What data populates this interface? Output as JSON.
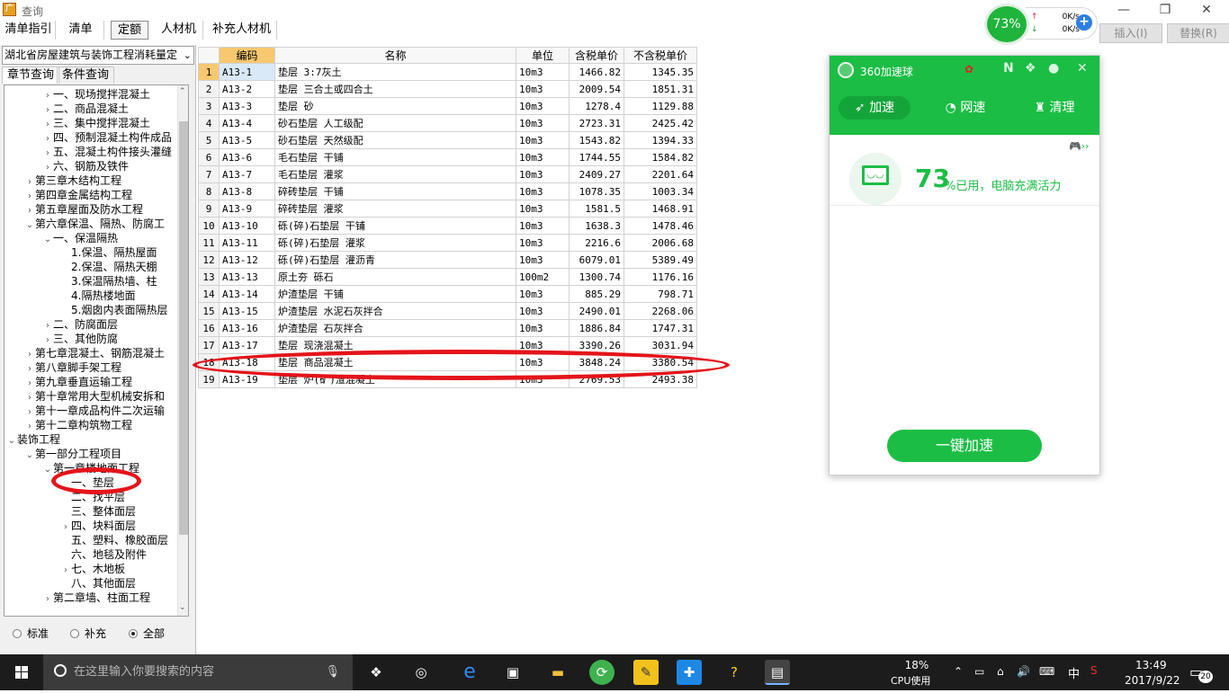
{
  "window": {
    "title": "查询",
    "minimize": "—",
    "maximize": "❐",
    "close": "✕"
  },
  "toolbar": {
    "tabs": [
      "清单指引",
      "清单",
      "定额",
      "人材机",
      "补充人材机"
    ],
    "active_tab": "定额",
    "insert_button": "插入(I)",
    "replace_button": "替换(R)"
  },
  "left_panel": {
    "standard_select": "湖北省房屋建筑与装饰工程消耗量定",
    "tabs": [
      "章节查询",
      "条件查询"
    ],
    "active_tab": "章节查询",
    "tree": [
      {
        "label": "一、现场搅拌混凝土",
        "level": 3,
        "expand": "›"
      },
      {
        "label": "二、商品混凝土",
        "level": 3,
        "expand": "›"
      },
      {
        "label": "三、集中搅拌混凝土",
        "level": 3,
        "expand": "›"
      },
      {
        "label": "四、预制混凝土构件成品",
        "level": 3,
        "expand": "›"
      },
      {
        "label": "五、混凝土构件接头灌缝",
        "level": 3,
        "expand": "›"
      },
      {
        "label": "六、钢筋及铁件",
        "level": 3,
        "expand": "›"
      },
      {
        "label": "第三章木结构工程",
        "level": 2,
        "expand": "›"
      },
      {
        "label": "第四章金属结构工程",
        "level": 2,
        "expand": "›"
      },
      {
        "label": "第五章屋面及防水工程",
        "level": 2,
        "expand": "›"
      },
      {
        "label": "第六章保温、隔热、防腐工",
        "level": 2,
        "expand": "⌄"
      },
      {
        "label": "一、保温隔热",
        "level": 3,
        "expand": "⌄"
      },
      {
        "label": "1.保温、隔热屋面",
        "level": 4,
        "expand": ""
      },
      {
        "label": "2.保温、隔热天棚",
        "level": 4,
        "expand": ""
      },
      {
        "label": "3.保温隔热墙、柱",
        "level": 4,
        "expand": ""
      },
      {
        "label": "4.隔热楼地面",
        "level": 4,
        "expand": ""
      },
      {
        "label": "5.烟囱内表面隔热层",
        "level": 4,
        "expand": ""
      },
      {
        "label": "二、防腐面层",
        "level": 3,
        "expand": "›"
      },
      {
        "label": "三、其他防腐",
        "level": 3,
        "expand": "›"
      },
      {
        "label": "第七章混凝土、钢筋混凝土",
        "level": 2,
        "expand": "›"
      },
      {
        "label": "第八章脚手架工程",
        "level": 2,
        "expand": "›"
      },
      {
        "label": "第九章垂直运输工程",
        "level": 2,
        "expand": "›"
      },
      {
        "label": "第十章常用大型机械安拆和",
        "level": 2,
        "expand": "›"
      },
      {
        "label": "第十一章成品构件二次运输",
        "level": 2,
        "expand": "›"
      },
      {
        "label": "第十二章构筑物工程",
        "level": 2,
        "expand": "›"
      },
      {
        "label": "装饰工程",
        "level": 1,
        "expand": "⌄"
      },
      {
        "label": "第一部分工程项目",
        "level": 2,
        "expand": "⌄"
      },
      {
        "label": "第一章楼地面工程",
        "level": 3,
        "expand": "⌄"
      },
      {
        "label": "一、垫层",
        "level": 4,
        "expand": ""
      },
      {
        "label": "二、找平层",
        "level": 4,
        "expand": ""
      },
      {
        "label": "三、整体面层",
        "level": 4,
        "expand": ""
      },
      {
        "label": "四、块料面层",
        "level": 4,
        "expand": "›"
      },
      {
        "label": "五、塑料、橡胶面层",
        "level": 4,
        "expand": ""
      },
      {
        "label": "六、地毯及附件",
        "level": 4,
        "expand": ""
      },
      {
        "label": "七、木地板",
        "level": 4,
        "expand": "›"
      },
      {
        "label": "八、其他面层",
        "level": 4,
        "expand": ""
      },
      {
        "label": "第二章墙、柱面工程",
        "level": 3,
        "expand": "›"
      }
    ],
    "radios": [
      {
        "label": "标准",
        "checked": false
      },
      {
        "label": "补充",
        "checked": false
      },
      {
        "label": "全部",
        "checked": true
      }
    ]
  },
  "grid": {
    "columns": [
      "",
      "编码",
      "名称",
      "单位",
      "含税单价",
      "不含税单价"
    ],
    "rows": [
      [
        "1",
        "A13-1",
        "垫层 3:7灰土",
        "10m3",
        "1466.82",
        "1345.35"
      ],
      [
        "2",
        "A13-2",
        "垫层 三合土或四合土",
        "10m3",
        "2009.54",
        "1851.31"
      ],
      [
        "3",
        "A13-3",
        "垫层 砂",
        "10m3",
        "1278.4",
        "1129.88"
      ],
      [
        "4",
        "A13-4",
        "砂石垫层 人工级配",
        "10m3",
        "2723.31",
        "2425.42"
      ],
      [
        "5",
        "A13-5",
        "砂石垫层 天然级配",
        "10m3",
        "1543.82",
        "1394.33"
      ],
      [
        "6",
        "A13-6",
        "毛石垫层 干铺",
        "10m3",
        "1744.55",
        "1584.82"
      ],
      [
        "7",
        "A13-7",
        "毛石垫层 灌浆",
        "10m3",
        "2409.27",
        "2201.64"
      ],
      [
        "8",
        "A13-8",
        "碎砖垫层 干铺",
        "10m3",
        "1078.35",
        "1003.34"
      ],
      [
        "9",
        "A13-9",
        "碎砖垫层 灌浆",
        "10m3",
        "1581.5",
        "1468.91"
      ],
      [
        "10",
        "A13-10",
        "砾(碎)石垫层 干铺",
        "10m3",
        "1638.3",
        "1478.46"
      ],
      [
        "11",
        "A13-11",
        "砾(碎)石垫层 灌浆",
        "10m3",
        "2216.6",
        "2006.68"
      ],
      [
        "12",
        "A13-12",
        "砾(碎)石垫层 灌沥青",
        "10m3",
        "6079.01",
        "5389.49"
      ],
      [
        "13",
        "A13-13",
        "原土夯 砾石",
        "100m2",
        "1300.74",
        "1176.16"
      ],
      [
        "14",
        "A13-14",
        "炉渣垫层 干铺",
        "10m3",
        "885.29",
        "798.71"
      ],
      [
        "15",
        "A13-15",
        "炉渣垫层 水泥石灰拌合",
        "10m3",
        "2490.01",
        "2268.06"
      ],
      [
        "16",
        "A13-16",
        "炉渣垫层 石灰拌合",
        "10m3",
        "1886.84",
        "1747.31"
      ],
      [
        "17",
        "A13-17",
        "垫层 现浇混凝土",
        "10m3",
        "3390.26",
        "3031.94"
      ],
      [
        "18",
        "A13-18",
        "垫层 商品混凝土",
        "10m3",
        "3848.24",
        "3380.54"
      ],
      [
        "19",
        "A13-19",
        "垫层 炉(矿)渣混凝土",
        "10m3",
        "2769.53",
        "2493.38"
      ]
    ]
  },
  "widget360": {
    "ball_percent": "73%",
    "upload_speed": "0K/s",
    "download_speed": "0K/s",
    "panel_title": "360加速球",
    "nav": [
      "加速",
      "网速",
      "清理"
    ],
    "usage_value": "73",
    "usage_label": "%已用，电脑充满活力",
    "accelerate_button": "一键加速",
    "colors": {
      "brand": "#1cbd45"
    }
  },
  "taskbar": {
    "search_placeholder": "在这里输入你要搜索的内容",
    "cpu_percent": "18%",
    "cpu_label": "CPU使用",
    "ime": "中",
    "time": "13:49",
    "date": "2017/9/22",
    "notification_count": "20"
  },
  "annotations": {
    "color": "#e4141a"
  }
}
